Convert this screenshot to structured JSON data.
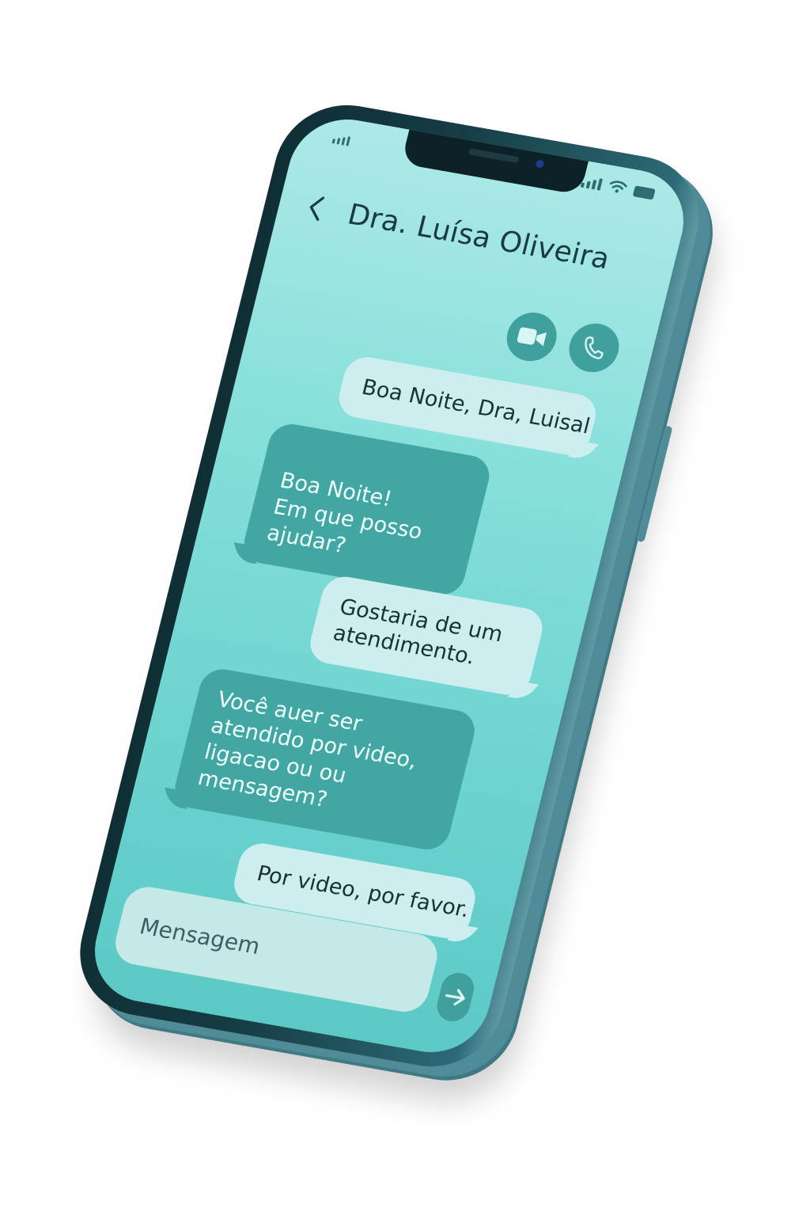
{
  "contact": {
    "name": "Dra. Luísa Oliveira"
  },
  "icons": {
    "back": "chevron-left-icon",
    "video": "video-camera-icon",
    "call": "phone-icon",
    "send": "arrow-right-icon"
  },
  "messages": [
    {
      "from": "user",
      "text": "Boa Noite, Dra, Luisal"
    },
    {
      "from": "doctor",
      "text": "Boa Noite!\nEm que posso ajudar?"
    },
    {
      "from": "user",
      "text": "Gostaria de um atendimento."
    },
    {
      "from": "doctor",
      "text": "Você auer ser atendido por video, ligacao ou ou mensagem?"
    },
    {
      "from": "user",
      "text": "Por video, por favor."
    }
  ],
  "composer": {
    "placeholder": "Mensagem"
  },
  "colors": {
    "screen_top": "#ade9e6",
    "screen_bottom": "#5cc9c5",
    "accent": "#3fa09d",
    "outgoing_bubble": "#cdeeee",
    "incoming_bubble": "#42a6a3",
    "frame": "#163c44"
  }
}
